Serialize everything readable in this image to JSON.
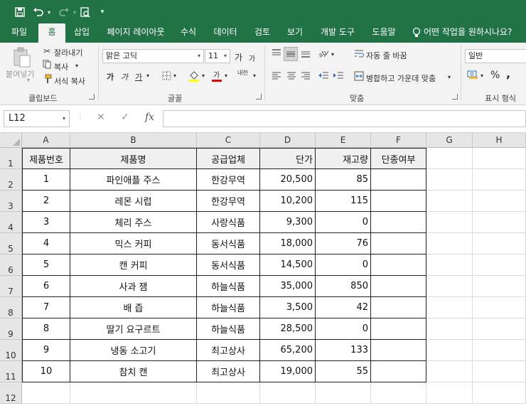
{
  "app": {
    "accent_color": "#217346"
  },
  "quick_access": {
    "save_icon": "save-icon",
    "undo_icon": "undo-icon",
    "redo_icon": "redo-icon",
    "preview_icon": "print-preview-icon",
    "customize_icon": "customize-qat-icon"
  },
  "tabs": [
    {
      "label": "파일"
    },
    {
      "label": "홈",
      "active": true
    },
    {
      "label": "삽입"
    },
    {
      "label": "페이지 레이아웃"
    },
    {
      "label": "수식"
    },
    {
      "label": "데이터"
    },
    {
      "label": "검토"
    },
    {
      "label": "보기"
    },
    {
      "label": "개발 도구"
    },
    {
      "label": "도움말"
    }
  ],
  "tell_me": "어떤 작업을 원하시나요?",
  "ribbon": {
    "clipboard": {
      "label": "클립보드",
      "paste": "붙여넣기",
      "cut": "잘라내기",
      "copy": "복사",
      "format_painter": "서식 복사"
    },
    "font": {
      "label": "글꼴",
      "font_name": "맑은 고딕",
      "font_size": "11",
      "grow": "가",
      "shrink": "가",
      "bold": "가",
      "italic": "가",
      "underline": "가",
      "phonetic": "내천"
    },
    "alignment": {
      "label": "맞춤",
      "wrap_text": "자동 줄 바꿈",
      "merge_center": "병합하고 가운데 맞춤"
    },
    "number": {
      "label": "표시 형식",
      "format": "일반",
      "percent": "%",
      "comma": ","
    }
  },
  "formula_bar": {
    "name_box": "L12",
    "cancel": "✕",
    "enter": "✓",
    "fx": "fx",
    "value": ""
  },
  "sheet": {
    "columns": [
      "A",
      "B",
      "C",
      "D",
      "E",
      "F",
      "G",
      "H"
    ],
    "rows": [
      "1",
      "2",
      "3",
      "4",
      "5",
      "6",
      "7",
      "8",
      "9",
      "10",
      "11",
      "12"
    ],
    "headers": [
      "제품번호",
      "제품명",
      "공급업체",
      "단가",
      "재고량",
      "단종여부"
    ],
    "data": [
      [
        "1",
        "파인애플 주스",
        "한강무역",
        "20,500",
        "85",
        ""
      ],
      [
        "2",
        "레몬 시럽",
        "한강무역",
        "10,200",
        "115",
        ""
      ],
      [
        "3",
        "체리 주스",
        "사랑식품",
        "9,300",
        "0",
        ""
      ],
      [
        "4",
        "믹스 커피",
        "동서식품",
        "18,000",
        "76",
        ""
      ],
      [
        "5",
        "캔 커피",
        "동서식품",
        "14,500",
        "0",
        ""
      ],
      [
        "6",
        "사과 잼",
        "하늘식품",
        "35,000",
        "850",
        ""
      ],
      [
        "7",
        "배 즙",
        "하늘식품",
        "3,500",
        "42",
        ""
      ],
      [
        "8",
        "딸기 요구르트",
        "하늘식품",
        "28,500",
        "0",
        ""
      ],
      [
        "9",
        "냉동 소고기",
        "최고상사",
        "65,200",
        "133",
        ""
      ],
      [
        "10",
        "참치 캔",
        "최고상사",
        "19,000",
        "55",
        ""
      ]
    ]
  }
}
